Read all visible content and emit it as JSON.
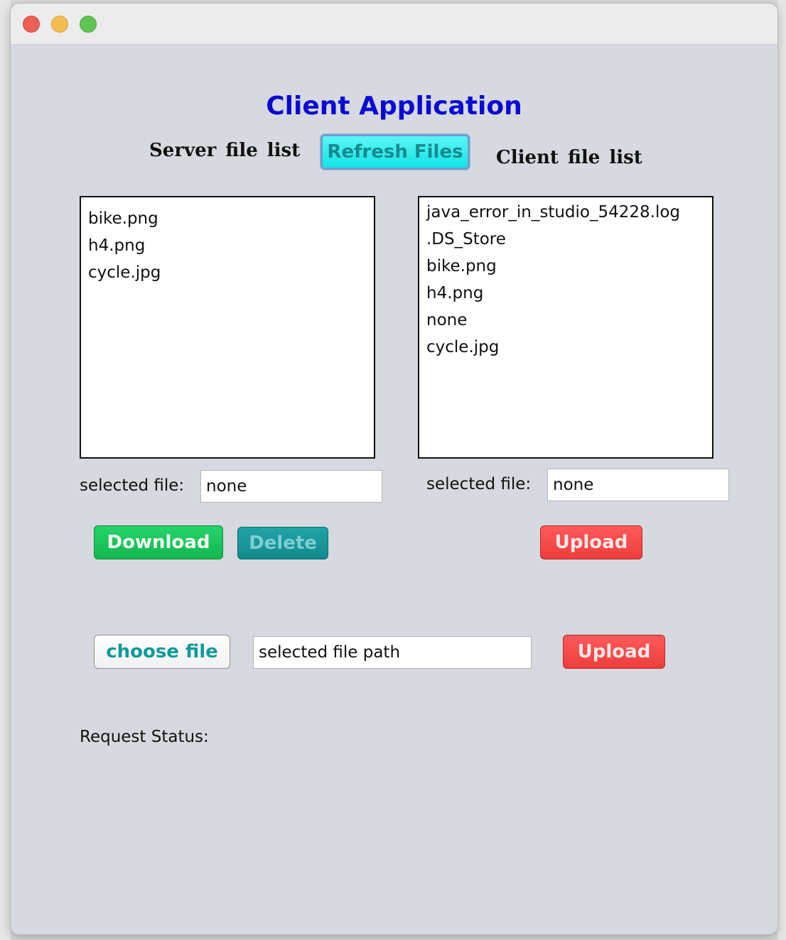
{
  "window": {
    "title": ""
  },
  "app": {
    "title": "Client Application"
  },
  "server": {
    "list_label": "Server  file  list",
    "files": [
      "bike.png",
      "h4.png",
      "cycle.jpg"
    ],
    "selected_label": "selected file:",
    "selected_value": "none",
    "download_label": "Download",
    "delete_label": "Delete"
  },
  "refresh_label": "Refresh Files",
  "client": {
    "list_label": "Client  file  list",
    "files": [
      "java_error_in_studio_54228.log",
      ".DS_Store",
      "bike.png",
      "h4.png",
      "none",
      "cycle.jpg"
    ],
    "selected_label": "selected file:",
    "selected_value": "none",
    "upload_label": "Upload"
  },
  "local": {
    "choose_label": "choose file",
    "path_value": "selected file path",
    "upload_label": "Upload"
  },
  "status": {
    "label": "Request Status:",
    "value": ""
  },
  "colors": {
    "title": "#0a0ad2",
    "refresh": "#14e3e6",
    "download": "#12b84f",
    "delete": "#138a8e",
    "upload": "#ee3d3d",
    "window_bg": "#d6d9df"
  }
}
